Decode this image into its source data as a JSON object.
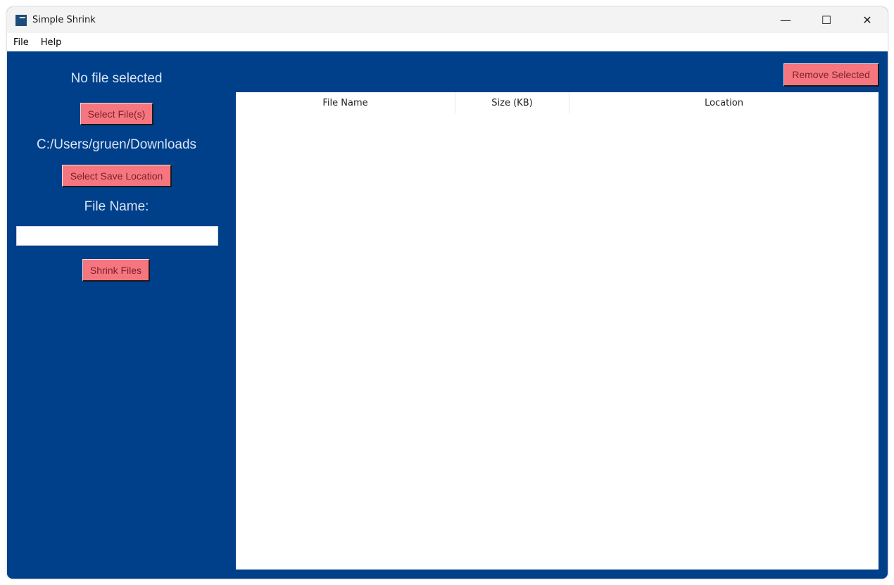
{
  "window": {
    "title": "Simple Shrink",
    "controls": {
      "minimize": "—",
      "maximize": "☐",
      "close": "✕"
    }
  },
  "menu": {
    "items": [
      "File",
      "Help"
    ]
  },
  "sidebar": {
    "file_status": "No file selected",
    "select_files_label": "Select File(s)",
    "save_path": "C:/Users/gruen/Downloads",
    "select_save_label": "Select Save Location",
    "file_name_label": "File Name:",
    "file_name_value": "",
    "shrink_label": "Shrink Files"
  },
  "main": {
    "remove_label": "Remove Selected",
    "table": {
      "columns": [
        "File Name",
        "Size (KB)",
        "Location"
      ],
      "rows": []
    }
  },
  "colors": {
    "background": "#003f8a",
    "button": "#f6767f",
    "button_text": "#7a1f2a"
  }
}
